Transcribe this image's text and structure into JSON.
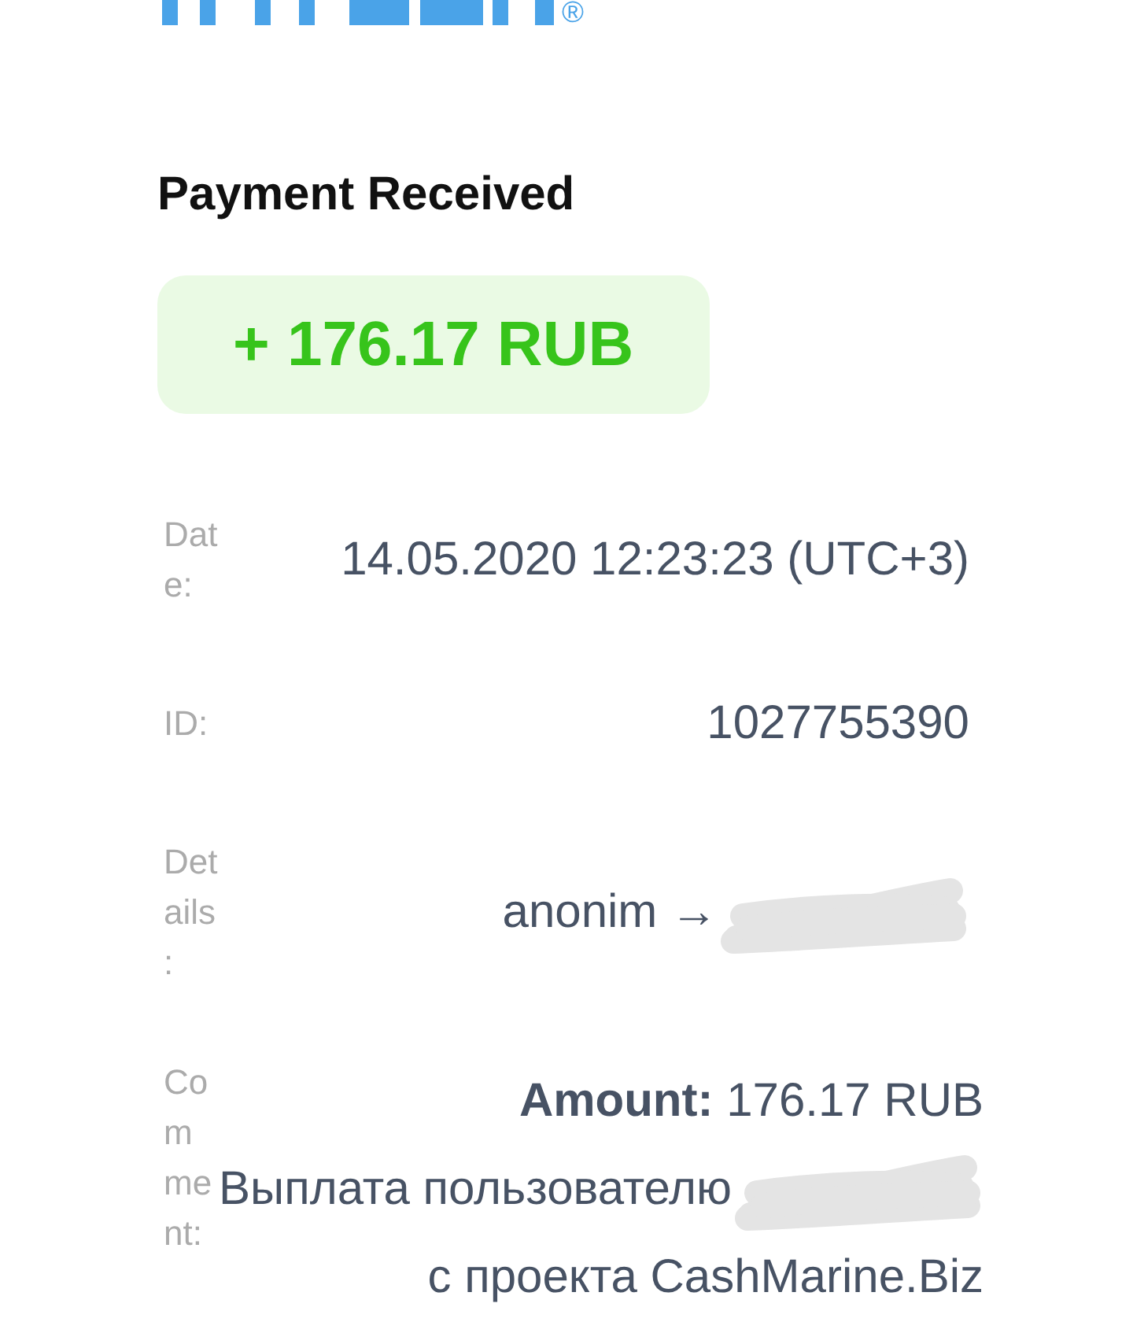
{
  "logo": {
    "registered_mark": "®"
  },
  "title": "Payment Received",
  "amount": "+ 176.17 RUB",
  "fields": [
    {
      "label": "Date:",
      "lines": [
        {
          "text": "14.05.2020 12:23:23 (UTC+3)",
          "redacted": false
        }
      ]
    },
    {
      "label": "ID:",
      "lines": [
        {
          "text": "1027755390",
          "redacted": false
        }
      ]
    },
    {
      "label": "Details:",
      "lines": [
        {
          "text": "anonim →",
          "redacted": true
        }
      ]
    },
    {
      "label": "Comment:",
      "lines": [
        {
          "text": "**Amount:** 176.17 RUB",
          "redacted": false
        },
        {
          "text": "Выплата пользователю",
          "redacted": true
        },
        {
          "text": "с проекта CashMarine.Biz",
          "redacted": false
        }
      ]
    }
  ]
}
